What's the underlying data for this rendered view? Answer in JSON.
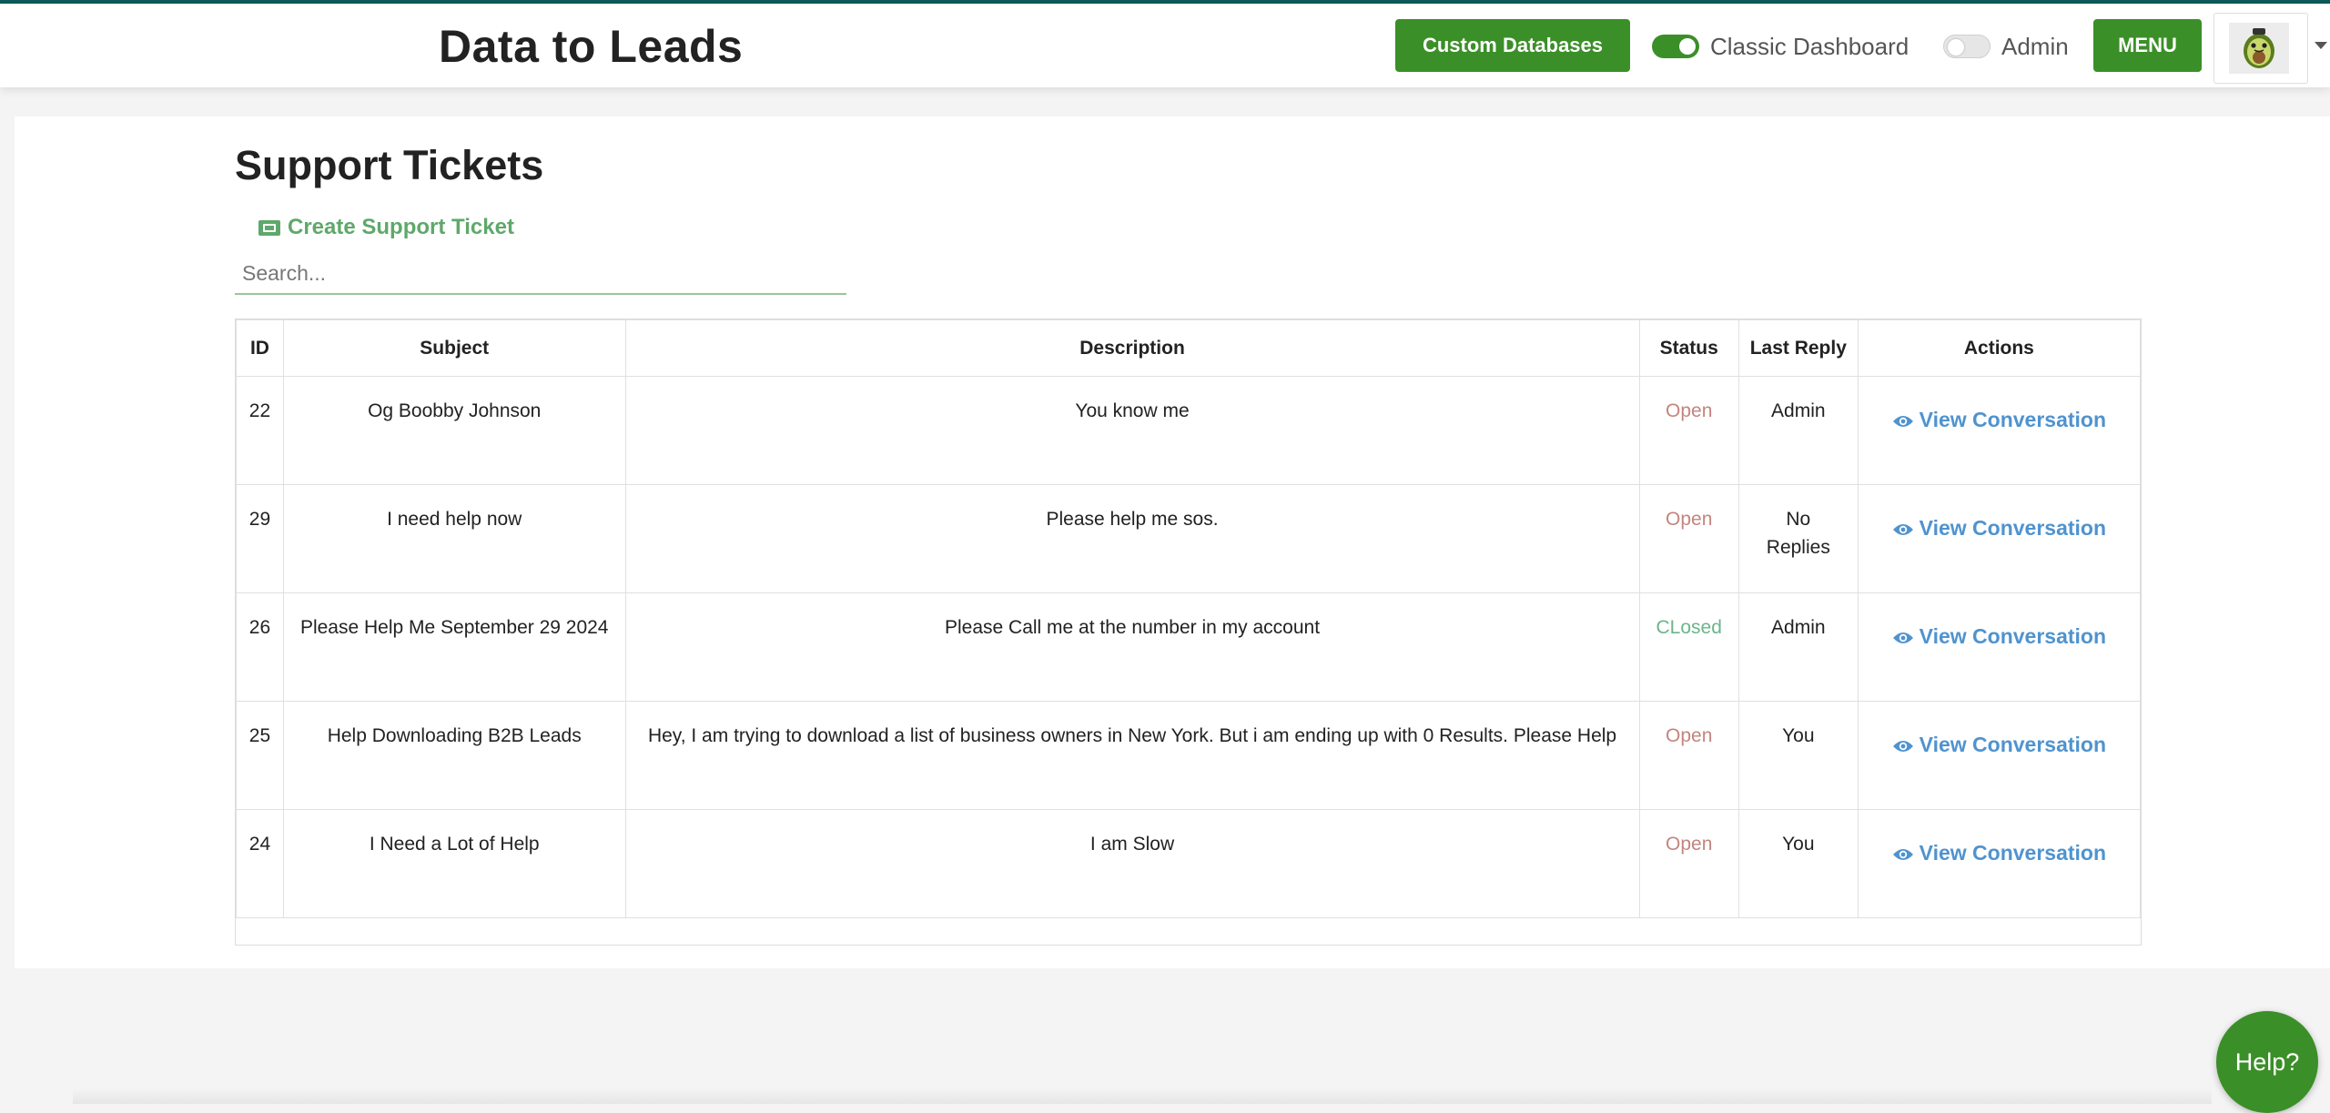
{
  "header": {
    "brand": "Data to Leads",
    "custom_db_label": "Custom Databases",
    "classic_toggle_label": "Classic Dashboard",
    "classic_toggle_on": true,
    "admin_toggle_label": "Admin",
    "admin_toggle_on": false,
    "menu_label": "MENU",
    "accent_color": "#3b8f28"
  },
  "page": {
    "title": "Support Tickets",
    "create_label": "Create Support Ticket",
    "search_placeholder": "Search..."
  },
  "table": {
    "columns": [
      "ID",
      "Subject",
      "Description",
      "Status",
      "Last Reply",
      "Actions"
    ],
    "rows": [
      {
        "id": "22",
        "subject": "Og Boobby Johnson",
        "description": "You know me",
        "status": "Open",
        "last_reply": "Admin",
        "action": "View Conversation"
      },
      {
        "id": "29",
        "subject": "I need help now",
        "description": "Please help me sos.",
        "status": "Open",
        "last_reply": "No Replies",
        "action": "View Conversation"
      },
      {
        "id": "26",
        "subject": "Please Help Me September 29 2024",
        "description": "Please Call me at the number in my account",
        "status": "CLosed",
        "last_reply": "Admin",
        "action": "View Conversation"
      },
      {
        "id": "25",
        "subject": "Help Downloading B2B Leads",
        "description": "Hey, I am trying to download a list of business owners in New York. But i am ending up with 0 Results. Please Help",
        "status": "Open",
        "last_reply": "You",
        "action": "View Conversation"
      },
      {
        "id": "24",
        "subject": "I Need a Lot of Help",
        "description": "I am Slow",
        "status": "Open",
        "last_reply": "You",
        "action": "View Conversation"
      }
    ]
  },
  "help_button": {
    "label": "Help?"
  },
  "icons": {
    "create": "ticket-icon",
    "view": "eye-icon",
    "avatar": "avocado-avatar-icon"
  }
}
